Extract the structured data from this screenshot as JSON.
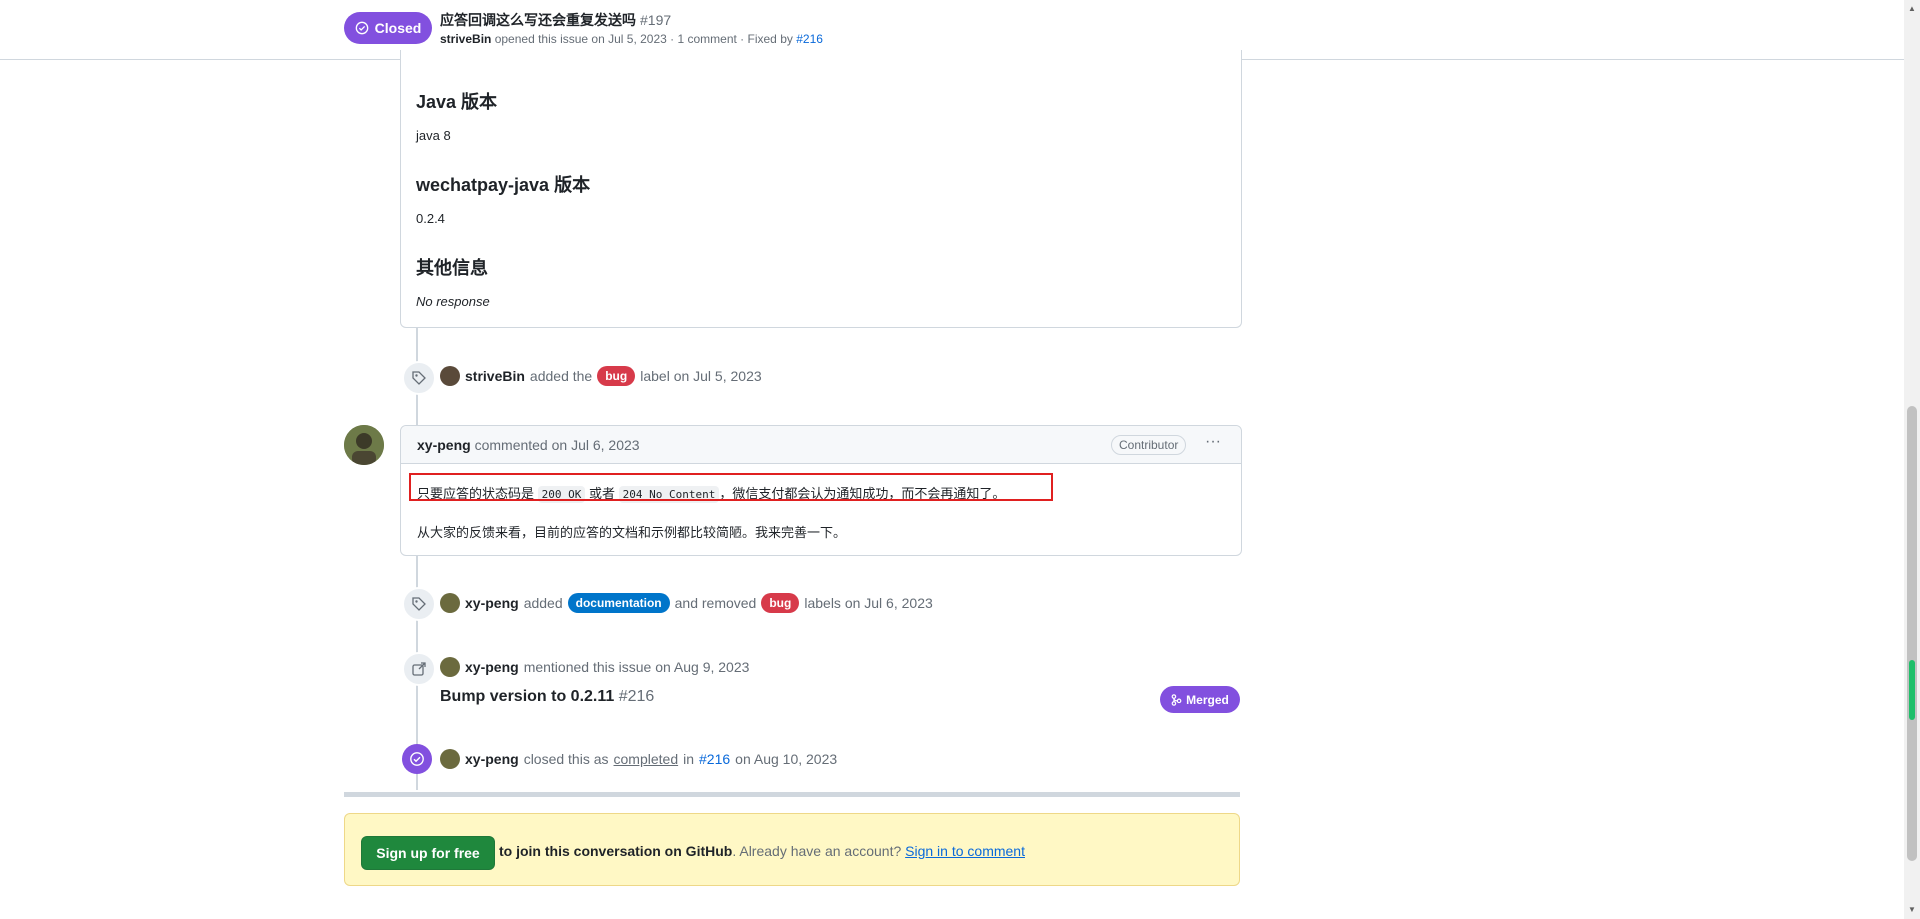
{
  "header": {
    "state": "Closed",
    "title": "应答回调这么写还会重复发送吗",
    "number": "#197",
    "meta_author": "striveBin",
    "meta_text": "opened this issue on Jul 5, 2023 · 1 comment · Fixed by",
    "meta_fixed_by": "#216"
  },
  "body": {
    "h_java": "Java 版本",
    "java_value": "java 8",
    "h_sdk": "wechatpay-java 版本",
    "sdk_value": "0.2.4",
    "h_other": "其他信息",
    "other_value": "No response"
  },
  "event_label_added": {
    "actor": "striveBin",
    "pre": "added the",
    "label": "bug",
    "post": "label on Jul 5, 2023"
  },
  "comment2": {
    "author": "xy-peng",
    "action": "commented on Jul 6, 2023",
    "badge": "Contributor",
    "menu": "···",
    "line1_a": "只要应答的状态码是",
    "code1": "200 OK",
    "line1_b": "或者",
    "code2": "204 No Content",
    "line1_c": "，微信支付都会认为通知成功，而不会再通知了。",
    "line2": "从大家的反馈来看，目前的应答的文档和示例都比较简陋。我来完善一下。"
  },
  "event_labels_changed": {
    "actor": "xy-peng",
    "pre": "added",
    "label_added": "documentation",
    "mid": "and removed",
    "label_removed": "bug",
    "post": "labels on Jul 6, 2023"
  },
  "event_mentioned": {
    "actor": "xy-peng",
    "text": "mentioned this issue on Aug 9, 2023",
    "ref_title": "Bump version to 0.2.11",
    "ref_number": "#216",
    "ref_state": "Merged"
  },
  "event_closed": {
    "actor": "xy-peng",
    "pre": "closed this as",
    "completed": "completed",
    "in": "in",
    "ref": "#216",
    "post": "on Aug 10, 2023"
  },
  "signup": {
    "button": "Sign up for free",
    "bold_text": "to join this conversation on GitHub",
    "text": ". Already have an account?",
    "link": "Sign in to comment"
  },
  "colors": {
    "closed_purple": "#8250df",
    "bug_label": "#d73a4a",
    "documentation_label": "#0075ca",
    "signup_green": "#1f883d",
    "highlight_red": "#e02020"
  }
}
